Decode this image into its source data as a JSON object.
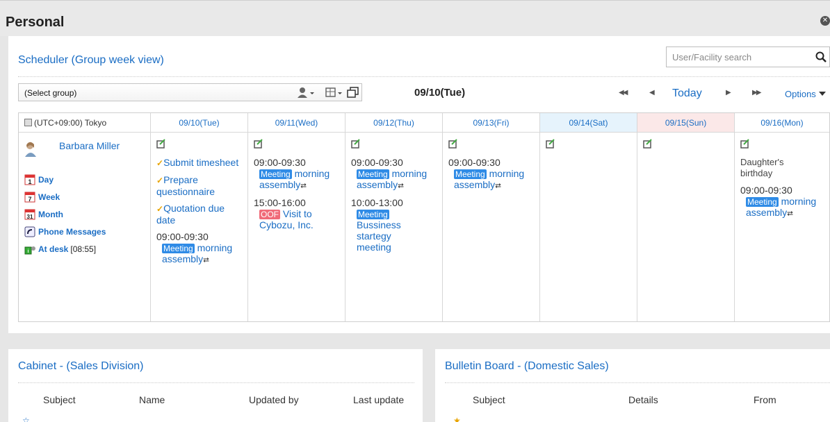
{
  "header": {
    "title": "Personal",
    "close_icon": "close-circle-icon"
  },
  "scheduler": {
    "title": "Scheduler (Group week view)",
    "search_placeholder": "User/Facility search",
    "group_select": "(Select group)",
    "current_date": "09/10(Tue)",
    "nav": {
      "first": "◀◀",
      "prev": "◀",
      "today": "Today",
      "next": "▶",
      "last": "▶▶"
    },
    "options_label": "Options",
    "timezone": "(UTC+09:00) Tokyo",
    "days": [
      {
        "label": "09/10(Tue)",
        "kind": "weekday"
      },
      {
        "label": "09/11(Wed)",
        "kind": "weekday"
      },
      {
        "label": "09/12(Thu)",
        "kind": "weekday"
      },
      {
        "label": "09/13(Fri)",
        "kind": "weekday"
      },
      {
        "label": "09/14(Sat)",
        "kind": "saturday"
      },
      {
        "label": "09/15(Sun)",
        "kind": "sunday"
      },
      {
        "label": "09/16(Mon)",
        "kind": "weekday"
      }
    ],
    "user": {
      "name": "Barbara Miller",
      "links": {
        "day": "Day",
        "week": "Week",
        "month": "Month",
        "phone": "Phone Messages",
        "presence": "At desk",
        "presence_time": "[08:55]"
      }
    },
    "tue": {
      "todo1": "Submit timesheet",
      "todo2": "Prepare questionnaire",
      "todo3": "Quotation due date",
      "e1": {
        "time": "09:00-09:30",
        "badge": "Meeting",
        "title_a": "morning",
        "title_b": "assembly"
      }
    },
    "wed": {
      "e1": {
        "time": "09:00-09:30",
        "badge": "Meeting",
        "title_a": "morning",
        "title_b": "assembly"
      },
      "e2": {
        "time": "15:00-16:00",
        "badge": "OOF",
        "title_a": "Visit to",
        "title_b": "Cybozu, Inc."
      }
    },
    "thu": {
      "e1": {
        "time": "09:00-09:30",
        "badge": "Meeting",
        "title_a": "morning",
        "title_b": "assembly"
      },
      "e2": {
        "time": "10:00-13:00",
        "badge": "Meeting",
        "title_a": "Bussiness",
        "title_b": "startegy",
        "title_c": "meeting"
      }
    },
    "fri": {
      "e1": {
        "time": "09:00-09:30",
        "badge": "Meeting",
        "title_a": "morning",
        "title_b": "assembly"
      }
    },
    "mon": {
      "note_a": "Daughter's",
      "note_b": "birthday",
      "e1": {
        "time": "09:00-09:30",
        "badge": "Meeting",
        "title_a": "morning",
        "title_b": "assembly"
      }
    },
    "colors": {
      "link": "#1a6dc4",
      "meeting": "#2f8be6",
      "oof": "#f06a78",
      "saturday": "#e6f3fc",
      "sunday": "#fbe8e8"
    }
  },
  "cabinet": {
    "title": "Cabinet - (Sales Division)",
    "columns": [
      "Subject",
      "Name",
      "Updated by",
      "Last update"
    ]
  },
  "bulletin": {
    "title": "Bulletin Board - (Domestic Sales)",
    "columns": [
      "Subject",
      "Details",
      "From"
    ]
  }
}
